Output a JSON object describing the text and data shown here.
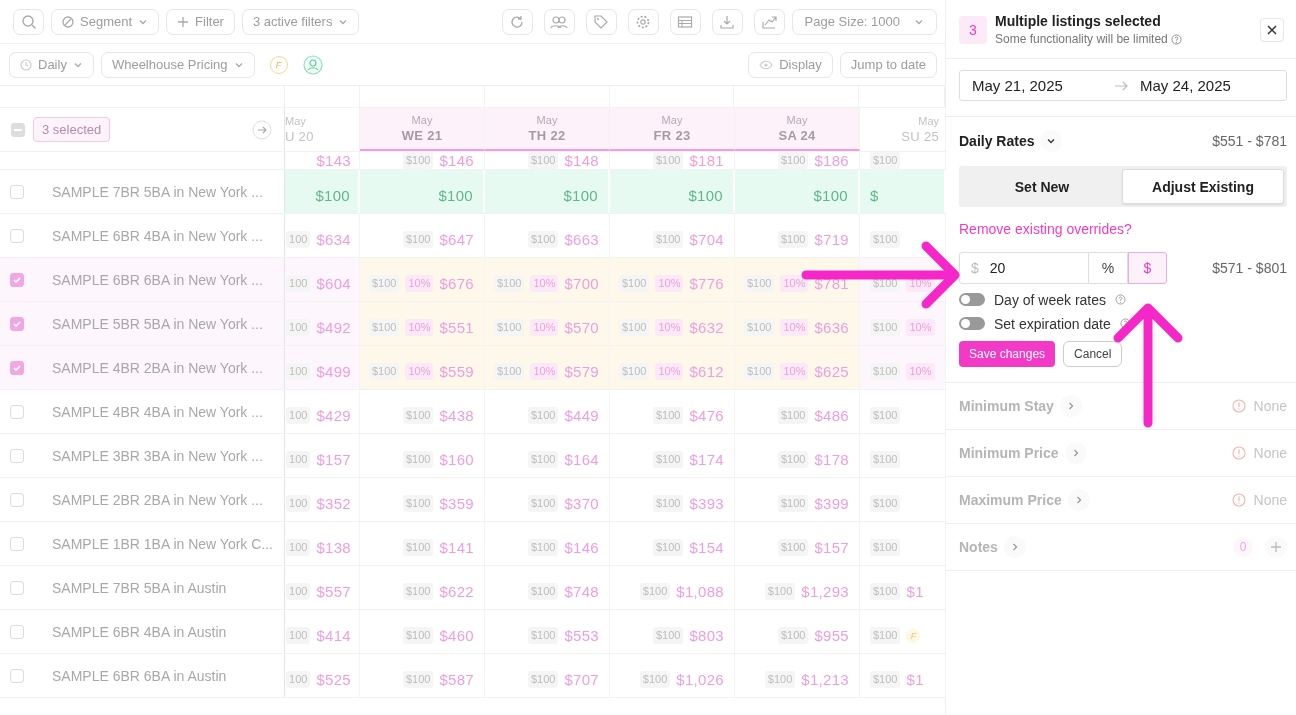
{
  "toolbar": {
    "segment": "Segment",
    "filter": "Filter",
    "active_filters": "3 active filters",
    "page_size": "Page Size: 1000"
  },
  "toolbar2": {
    "period": "Daily",
    "pricing": "Wheelhouse Pricing",
    "badge": "F",
    "display": "Display",
    "jump": "Jump to date"
  },
  "grid": {
    "select_all_indeterminate": true,
    "selected_label": "3 selected",
    "dates": [
      {
        "month": "May",
        "day": "U 20",
        "selected": false
      },
      {
        "month": "May",
        "day": "WE 21",
        "selected": true
      },
      {
        "month": "May",
        "day": "TH 22",
        "selected": true
      },
      {
        "month": "May",
        "day": "FR 23",
        "selected": true
      },
      {
        "month": "May",
        "day": "SA 24",
        "selected": true
      },
      {
        "month": "May",
        "day": "SU 25",
        "selected": false
      }
    ],
    "rows": [
      {
        "kind": "cut",
        "cells": [
          {
            "price": "$143"
          },
          {
            "base": "$100",
            "price": "$146"
          },
          {
            "base": "$100",
            "price": "$148"
          },
          {
            "base": "$100",
            "price": "$181"
          },
          {
            "base": "$100",
            "price": "$186"
          },
          {
            "base": "$100"
          }
        ]
      },
      {
        "kind": "blocked",
        "name": "SAMPLE 7BR 5BA in New York ...",
        "checked": false,
        "cells": [
          {
            "price": "$100"
          },
          {
            "price": "$100"
          },
          {
            "price": "$100"
          },
          {
            "price": "$100"
          },
          {
            "price": "$100"
          },
          {
            "price": "$"
          }
        ]
      },
      {
        "kind": "normal",
        "name": "SAMPLE 6BR 4BA in New York ...",
        "checked": false,
        "cells": [
          {
            "base": "100",
            "price": "$634"
          },
          {
            "base": "$100",
            "price": "$647"
          },
          {
            "base": "$100",
            "price": "$663"
          },
          {
            "base": "$100",
            "price": "$704"
          },
          {
            "base": "$100",
            "price": "$719"
          },
          {
            "base": "$100"
          }
        ]
      },
      {
        "kind": "normal",
        "name": "SAMPLE 6BR 6BA in New York ...",
        "checked": true,
        "cells": [
          {
            "base": "100",
            "price": "$604"
          },
          {
            "base": "$100",
            "pct": "10%",
            "price": "$676"
          },
          {
            "base": "$100",
            "pct": "10%",
            "price": "$700"
          },
          {
            "base": "$100",
            "pct": "10%",
            "price": "$776"
          },
          {
            "base": "$100",
            "pct": "10%",
            "price": "$781"
          },
          {
            "base": "$100",
            "pct": "10%"
          }
        ]
      },
      {
        "kind": "normal",
        "name": "SAMPLE 5BR 5BA in New York ...",
        "checked": true,
        "cells": [
          {
            "base": "100",
            "price": "$492"
          },
          {
            "base": "$100",
            "pct": "10%",
            "price": "$551"
          },
          {
            "base": "$100",
            "pct": "10%",
            "price": "$570"
          },
          {
            "base": "$100",
            "pct": "10%",
            "price": "$632"
          },
          {
            "base": "$100",
            "pct": "10%",
            "price": "$636"
          },
          {
            "base": "$100",
            "pct": "10%"
          }
        ]
      },
      {
        "kind": "normal",
        "name": "SAMPLE 4BR 2BA in New York ...",
        "checked": true,
        "cells": [
          {
            "base": "100",
            "price": "$499"
          },
          {
            "base": "$100",
            "pct": "10%",
            "price": "$559"
          },
          {
            "base": "$100",
            "pct": "10%",
            "price": "$579"
          },
          {
            "base": "$100",
            "pct": "10%",
            "price": "$612"
          },
          {
            "base": "$100",
            "pct": "10%",
            "price": "$625"
          },
          {
            "base": "$100",
            "pct": "10%"
          }
        ]
      },
      {
        "kind": "normal",
        "name": "SAMPLE 4BR 4BA in New York ...",
        "checked": false,
        "cells": [
          {
            "base": "100",
            "price": "$429"
          },
          {
            "base": "$100",
            "price": "$438"
          },
          {
            "base": "$100",
            "price": "$449"
          },
          {
            "base": "$100",
            "price": "$476"
          },
          {
            "base": "$100",
            "price": "$486"
          },
          {
            "base": "$100"
          }
        ]
      },
      {
        "kind": "normal",
        "name": "SAMPLE 3BR 3BA in New York ...",
        "checked": false,
        "cells": [
          {
            "base": "100",
            "price": "$157"
          },
          {
            "base": "$100",
            "price": "$160"
          },
          {
            "base": "$100",
            "price": "$164"
          },
          {
            "base": "$100",
            "price": "$174"
          },
          {
            "base": "$100",
            "price": "$178"
          },
          {
            "base": "$100"
          }
        ]
      },
      {
        "kind": "normal",
        "name": "SAMPLE 2BR 2BA in New York ...",
        "checked": false,
        "cells": [
          {
            "base": "100",
            "price": "$352"
          },
          {
            "base": "$100",
            "price": "$359"
          },
          {
            "base": "$100",
            "price": "$370"
          },
          {
            "base": "$100",
            "price": "$393"
          },
          {
            "base": "$100",
            "price": "$399"
          },
          {
            "base": "$100"
          }
        ]
      },
      {
        "kind": "normal",
        "name": "SAMPLE 1BR 1BA in New York C...",
        "checked": false,
        "cells": [
          {
            "base": "100",
            "price": "$138"
          },
          {
            "base": "$100",
            "price": "$141"
          },
          {
            "base": "$100",
            "price": "$146"
          },
          {
            "base": "$100",
            "price": "$154"
          },
          {
            "base": "$100",
            "price": "$157"
          },
          {
            "base": "$100"
          }
        ]
      },
      {
        "kind": "normal",
        "name": "SAMPLE 7BR 5BA in Austin",
        "checked": false,
        "cells": [
          {
            "base": "100",
            "price": "$557"
          },
          {
            "base": "$100",
            "price": "$622"
          },
          {
            "base": "$100",
            "price": "$748"
          },
          {
            "base": "$100",
            "price": "$1,088"
          },
          {
            "base": "$100",
            "price": "$1,293"
          },
          {
            "base": "$100",
            "price": "$1"
          }
        ]
      },
      {
        "kind": "normal",
        "name": "SAMPLE 6BR 4BA in Austin",
        "checked": false,
        "cells": [
          {
            "base": "100",
            "price": "$414"
          },
          {
            "base": "$100",
            "price": "$460"
          },
          {
            "base": "$100",
            "price": "$553"
          },
          {
            "base": "$100",
            "price": "$803"
          },
          {
            "base": "$100",
            "price": "$955"
          },
          {
            "base": "$100",
            "flag": "F"
          }
        ]
      },
      {
        "kind": "normal",
        "name": "SAMPLE 6BR 6BA in Austin",
        "checked": false,
        "cells": [
          {
            "base": "100",
            "price": "$525"
          },
          {
            "base": "$100",
            "price": "$587"
          },
          {
            "base": "$100",
            "price": "$707"
          },
          {
            "base": "$100",
            "price": "$1,026"
          },
          {
            "base": "$100",
            "price": "$1,213"
          },
          {
            "base": "$100",
            "price": "$1"
          }
        ]
      }
    ]
  },
  "panel": {
    "count": "3",
    "title": "Multiple listings selected",
    "subtitle": "Some functionality will be limited",
    "date_from": "May 21, 2025",
    "date_to": "May 24, 2025",
    "rates_title": "Daily Rates",
    "rates_range": "$551 - $781",
    "modes": [
      {
        "label": "Set New",
        "selected": false
      },
      {
        "label": "Adjust Existing",
        "selected": true
      }
    ],
    "remove_link": "Remove existing overrides?",
    "amount": {
      "prefix": "$",
      "value": "20"
    },
    "units": [
      {
        "label": "%",
        "selected": false
      },
      {
        "label": "$",
        "selected": true
      }
    ],
    "new_range": "$571 - $801",
    "toggles": [
      {
        "label": "Day of week rates",
        "on": false
      },
      {
        "label": "Set expiration date",
        "on": false
      }
    ],
    "save": "Save changes",
    "cancel": "Cancel",
    "sections": [
      {
        "title": "Minimum Stay",
        "value": "None",
        "disabled": true
      },
      {
        "title": "Minimum Price",
        "value": "None",
        "disabled": true
      },
      {
        "title": "Maximum Price",
        "value": "None",
        "disabled": true
      },
      {
        "title": "Notes",
        "count": "0",
        "disabled": true
      }
    ]
  },
  "annotations": [
    {
      "kind": "arrow"
    },
    {
      "kind": "arrow"
    }
  ]
}
